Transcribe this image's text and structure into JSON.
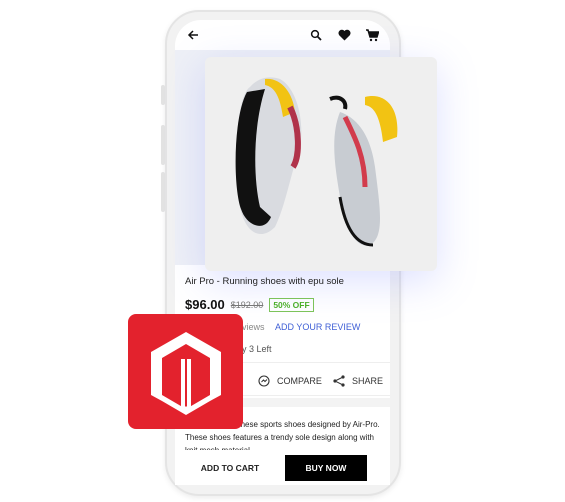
{
  "header": {
    "icons": [
      "arrow-left-icon",
      "search-icon",
      "heart-icon",
      "cart-icon"
    ]
  },
  "product": {
    "title": "Air Pro - Running shoes with epu sole",
    "price": "$96.00",
    "old_price": "$192.00",
    "discount": "50% OFF",
    "reviews": "views",
    "add_review": "ADD YOUR REVIEW",
    "stock": "ly 3 Left",
    "description": "porty look with these sports shoes designed by Air-Pro. These shoes features a trendy sole design along with knit mesh material"
  },
  "actions": {
    "compare": "COMPARE",
    "share": "SHARE"
  },
  "bottom": {
    "add_to_cart": "ADD TO CART",
    "buy_now": "BUY NOW"
  },
  "colors": {
    "brand_red": "#e3222d",
    "link": "#3f5fd6",
    "discount": "#4caf2b"
  }
}
